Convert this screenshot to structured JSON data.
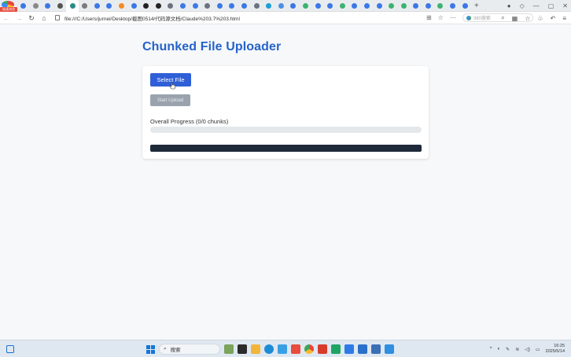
{
  "browser": {
    "app_badge": "极速浏览",
    "url": "file:///C:/Users/jurnei/Desktop/截图0514/代码源文档/Claude%203.7%203.html",
    "search_placeholder": "360搜索",
    "tab_favicon_colors": [
      "#3b78e7",
      "#888888",
      "#3b78e7",
      "#555555",
      "#2b8a8a",
      "#7a7a7a",
      "#3b78e7",
      "#3b78e7",
      "#f28b20",
      "#3b78e7",
      "#222222",
      "#222222",
      "#6b7280",
      "#3b78e7",
      "#3b78e7",
      "#6b7280",
      "#3b78e7",
      "#3b78e7",
      "#3b78e7",
      "#6b7280",
      "#1a9fd6",
      "#4a90e2",
      "#3b78e7",
      "#3cb371",
      "#3b78e7",
      "#3b78e7",
      "#3cb371",
      "#3b78e7",
      "#3b78e7",
      "#3b78e7",
      "#3cb371",
      "#3cb371",
      "#3b78e7",
      "#3b78e7",
      "#3cb371",
      "#3b78e7",
      "#3b78e7"
    ]
  },
  "page": {
    "title": "Chunked File Uploader",
    "select_button": "Select File",
    "start_button": "Start Upload",
    "progress_label": "Overall Progress (0/0 chunks)",
    "progress_fraction": 0
  },
  "taskbar": {
    "search_label": "搜索",
    "time": "16:25",
    "date": "2025/5/14"
  },
  "colors": {
    "accent": "#2f5fd6",
    "title": "#2563c9",
    "disabled": "#9aa3ad",
    "chunk_panel": "#1e2a3a"
  }
}
